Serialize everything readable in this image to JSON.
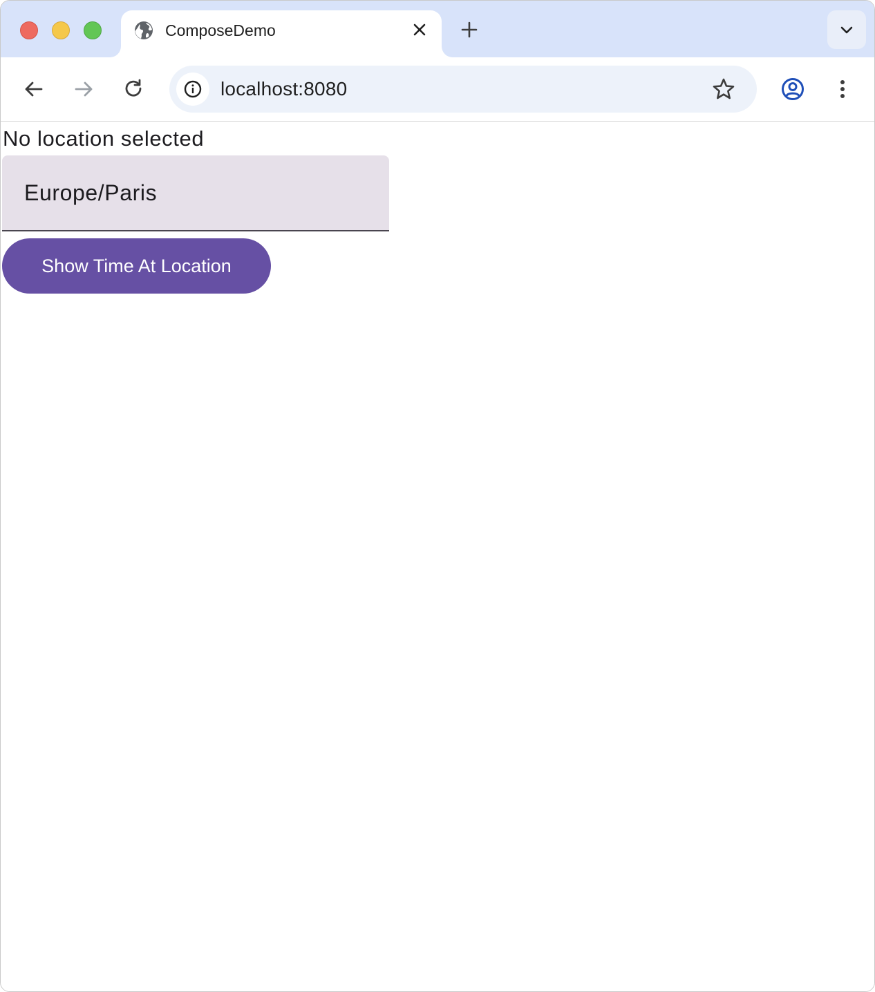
{
  "browser": {
    "tab": {
      "title": "ComposeDemo",
      "favicon": "globe-icon"
    },
    "address_bar": {
      "url": "localhost:8080"
    },
    "icons": {
      "back": "arrow-left-icon",
      "forward": "arrow-right-icon",
      "reload": "reload-icon",
      "site_info": "info-icon",
      "bookmark": "star-icon",
      "profile": "profile-icon",
      "menu": "kebab-menu-icon",
      "new_tab": "plus-icon",
      "close_tab": "close-icon",
      "tab_search": "chevron-down-icon"
    },
    "colors": {
      "tabstrip": "#d8e3fa",
      "omnibox": "#edf2fa",
      "profile_accent": "#1f4fb8"
    }
  },
  "page": {
    "status_text": "No location selected",
    "location_field": {
      "value": "Europe/Paris"
    },
    "show_time_button": {
      "label": "Show Time At Location"
    },
    "colors": {
      "button_bg": "#6650a4",
      "field_bg": "#e6e0e9",
      "field_underline": "#49454f"
    }
  }
}
